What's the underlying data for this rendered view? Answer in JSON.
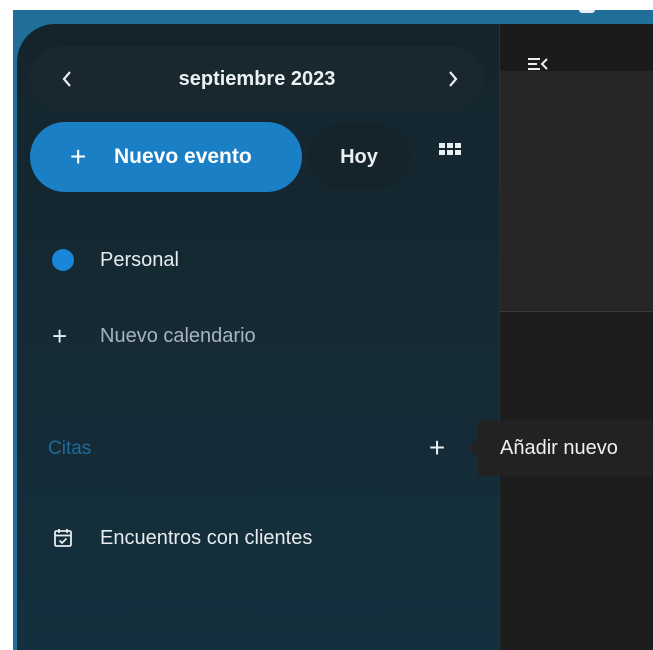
{
  "header": {
    "month_label": "septiembre 2023",
    "prev_glyph": "‹",
    "next_glyph": "›"
  },
  "actions": {
    "new_event_plus": "+",
    "new_event_label": "Nuevo evento",
    "today_label": "Hoy"
  },
  "calendars": {
    "items": [
      {
        "label": "Personal",
        "color": "#1a86d9"
      }
    ],
    "add_plus": "+",
    "add_label": "Nuevo calendario"
  },
  "appointments": {
    "section_title": "Citas",
    "add_plus": "+",
    "tooltip": "Añadir nuevo",
    "items": [
      {
        "label": "Encuentros con clientes",
        "icon": "calendar-check-icon"
      }
    ]
  },
  "colors": {
    "accent": "#1a7fc4",
    "section_title": "#1e6a99",
    "frame": "#1f6f9a"
  }
}
